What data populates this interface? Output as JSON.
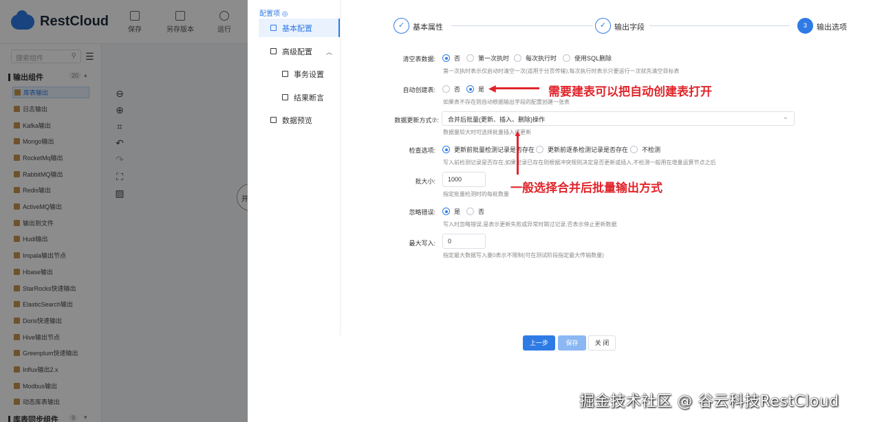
{
  "app": {
    "logo_text": "RestCloud",
    "toolbar": [
      {
        "label": "保存",
        "icon": "save-icon"
      },
      {
        "label": "另存版本",
        "icon": "copy-icon"
      },
      {
        "label": "运行",
        "icon": "run-icon"
      }
    ],
    "search_placeholder": "搜索组件",
    "groups": [
      {
        "title": "输出组件",
        "count": "20"
      },
      {
        "title": "库表同步组件",
        "count": "9"
      }
    ],
    "components": [
      "库表输出",
      "日志输出",
      "Kafka输出",
      "Mongo输出",
      "RocketMq输出",
      "RabbitMQ输出",
      "Redis输出",
      "ActiveMQ输出",
      "输出到文件",
      "Hudi输出",
      "Impala输出节点",
      "Hbase输出",
      "StarRocks快速输出",
      "ElasticSearch输出",
      "Doris快速输出",
      "Hive输出节点",
      "Greenplum快速输出",
      "Influx输出2.x",
      "Modbus输出",
      "动态库表输出"
    ],
    "canvas_node_label": "开"
  },
  "drawer": {
    "nav_title": "配置项",
    "nav_items": [
      {
        "label": "基本配置",
        "active": true
      },
      {
        "label": "高级配置"
      },
      {
        "label": "事务设置"
      },
      {
        "label": "结果断言"
      },
      {
        "label": "数据预览"
      }
    ],
    "steps": [
      {
        "label": "基本属性",
        "mark": "✓"
      },
      {
        "label": "输出字段",
        "mark": "✓"
      },
      {
        "label": "输出选项",
        "mark": "3"
      }
    ],
    "form": {
      "clear_table": {
        "label": "清空表数据:",
        "options": [
          "否",
          "第一次执时",
          "每次执行时",
          "使用SQL删除"
        ],
        "hint": "第一次执时表示仅启动时清空一次(适用于分页传输),每次执行时表示只要运行一次就先清空目标表"
      },
      "auto_create": {
        "label": "自动创建表:",
        "options": [
          "否",
          "是"
        ],
        "hint": "如果表不存在则自动根据输出字段的配置创建一张表"
      },
      "update_mode": {
        "label": "数据更新方式⑦:",
        "value": "合并后批量(更新、插入、删除)操作",
        "hint": "数据量较大时可选择批量插入或更新"
      },
      "check_option": {
        "label": "检查选项:",
        "options": [
          "更新前批量检测记录是否存在",
          "更新前逐条检测记录是否存在",
          "不检测"
        ],
        "hint": "写入前检测记录是否存在,如果记录已存在则根据冲突规则决定是否更新或插入,不检测一般用在增量运算节点之后"
      },
      "batch_size": {
        "label": "批大小:",
        "value": "1000",
        "hint": "指定批量检测时的每批数量"
      },
      "ignore_error": {
        "label": "忽略错误:",
        "options": [
          "是",
          "否"
        ],
        "hint": "写入时忽略错误,是表示更新失败或异常时跳过记录,否表示停止更新数据"
      },
      "max_write": {
        "label": "最大写入:",
        "value": "0",
        "hint": "指定最大数据写入量0表示不限制(可在测试阶段指定最大传输数量)"
      }
    },
    "annotations": {
      "auto_create_note": "需要建表可以把自动创建表打开",
      "update_mode_note": "一般选择合并后批量输出方式"
    },
    "buttons": {
      "prev": "上一步",
      "save": "保存",
      "close": "关 闭"
    }
  },
  "watermark": "掘金技术社区 @ 谷云科技RestCloud",
  "colors": {
    "primary": "#2f7be5",
    "annotation": "#e0242a"
  }
}
